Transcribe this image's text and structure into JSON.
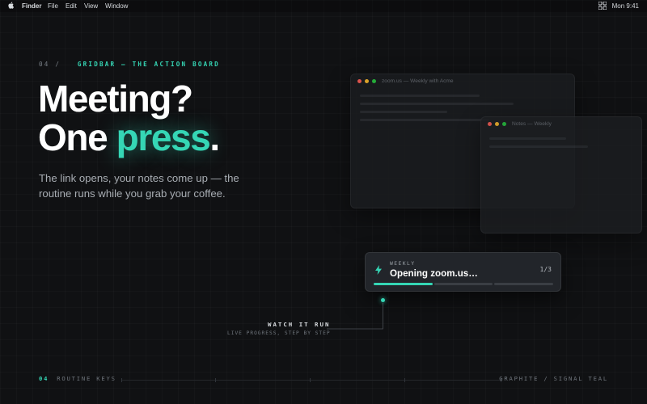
{
  "menubar": {
    "app": "Finder",
    "items": [
      "File",
      "Edit",
      "View",
      "Window"
    ],
    "clock": "Mon 9:41"
  },
  "hero": {
    "index": "04 /",
    "section_title": "GRIDBAR — THE ACTION BOARD",
    "headline_line1": "Meeting?",
    "headline_line2_start": "One ",
    "headline_accent": "press",
    "headline_end": ".",
    "subtitle": "The link opens, your notes come up — the routine runs while you grab your coffee."
  },
  "windows": {
    "zoom_title": "zoom.us — Weekly with Acme",
    "notes_title": "Notes — Weekly"
  },
  "toast": {
    "tag": "WEEKLY",
    "message": "Opening zoom.us…",
    "step": "1/3",
    "progress": [
      1.0,
      0.0,
      0.0
    ]
  },
  "callout": {
    "title": "WATCH IT RUN",
    "subtitle": "LIVE PROGRESS, STEP BY STEP"
  },
  "footer": {
    "index": "04",
    "left_label": "ROUTINE KEYS",
    "right_label": "GRAPHITE / SIGNAL TEAL"
  },
  "colors": {
    "accent": "#35d6b5",
    "background": "#101113",
    "dot_red": "#ff5f57",
    "dot_yellow": "#febc2e",
    "dot_green": "#28c840"
  }
}
